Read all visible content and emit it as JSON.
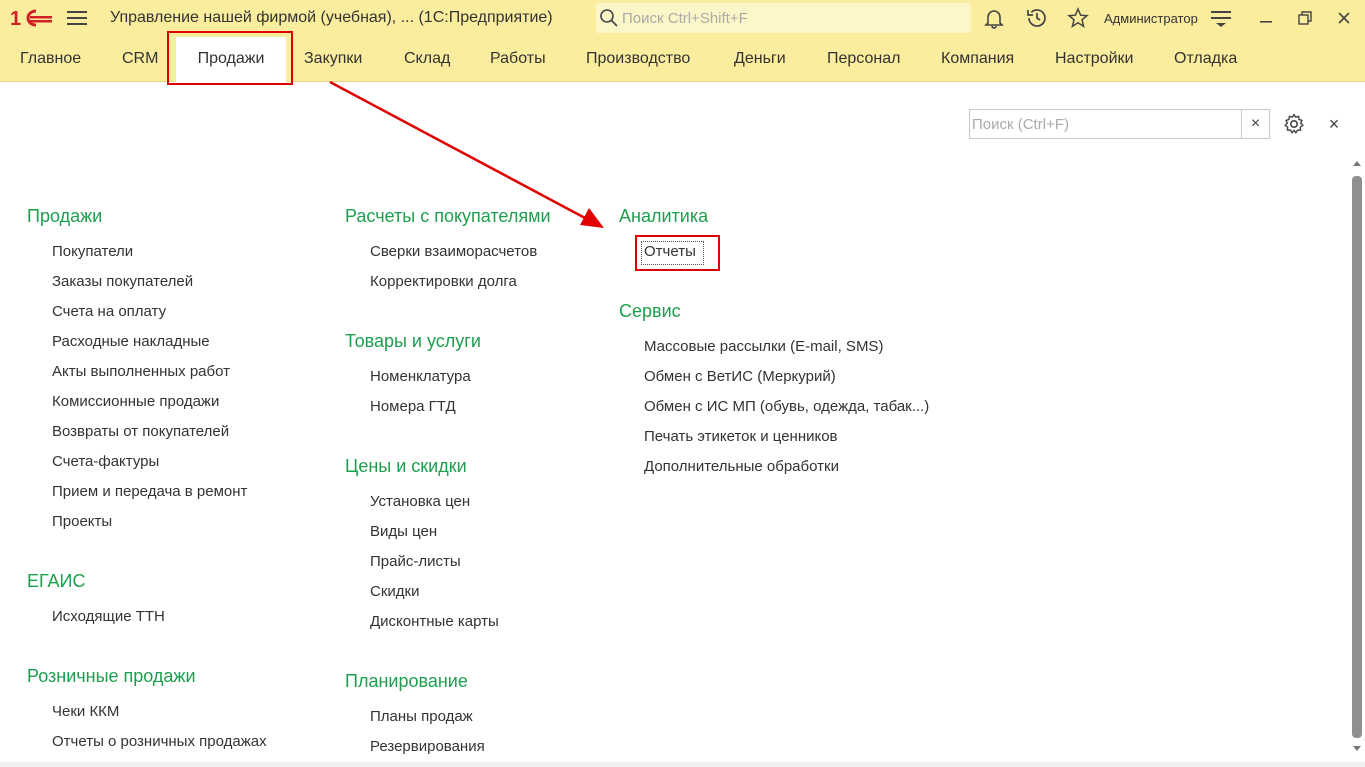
{
  "titlebar": {
    "title": "Управление нашей фирмой (учебная), ...   (1С:Предприятие)",
    "search_placeholder": "Поиск Ctrl+Shift+F",
    "user": "Администратор"
  },
  "menu": {
    "items": [
      "Главное",
      "CRM",
      "Продажи",
      "Закупки",
      "Склад",
      "Работы",
      "Производство",
      "Деньги",
      "Персонал",
      "Компания",
      "Настройки",
      "Отладка"
    ],
    "active": "Продажи"
  },
  "panel": {
    "search_placeholder": "Поиск (Ctrl+F)",
    "clear_glyph": "×",
    "close_glyph": "×"
  },
  "groups": {
    "sales": {
      "title": "Продажи",
      "items": [
        "Покупатели",
        "Заказы покупателей",
        "Счета на оплату",
        "Расходные накладные",
        "Акты выполненных работ",
        "Комиссионные продажи",
        "Возвраты от покупателей",
        "Счета-фактуры",
        "Прием и передача в ремонт",
        "Проекты"
      ]
    },
    "egais": {
      "title": "ЕГАИС",
      "items": [
        "Исходящие ТТН"
      ]
    },
    "retail": {
      "title": "Розничные продажи",
      "items": [
        "Чеки ККМ",
        "Отчеты о розничных продажах"
      ]
    },
    "settlements": {
      "title": "Расчеты с покупателями",
      "items": [
        "Сверки взаиморасчетов",
        "Корректировки долга"
      ]
    },
    "goods": {
      "title": "Товары и услуги",
      "items": [
        "Номенклатура",
        "Номера ГТД"
      ]
    },
    "prices": {
      "title": "Цены и скидки",
      "items": [
        "Установка цен",
        "Виды цен",
        "Прайс-листы",
        "Скидки",
        "Дисконтные карты"
      ]
    },
    "planning": {
      "title": "Планирование",
      "items": [
        "Планы продаж",
        "Резервирования"
      ]
    },
    "analytics": {
      "title": "Аналитика",
      "items": [
        "Отчеты"
      ]
    },
    "service": {
      "title": "Сервис",
      "items": [
        "Массовые рассылки (E-mail, SMS)",
        "Обмен с ВетИС (Меркурий)",
        "Обмен с ИС МП (обувь, одежда, табак...)",
        "Печать этикеток и ценников",
        "Дополнительные обработки"
      ]
    }
  },
  "colors": {
    "header_bg": "#fbed9e",
    "group_title": "#1e9e4e",
    "highlight": "#e00000"
  }
}
